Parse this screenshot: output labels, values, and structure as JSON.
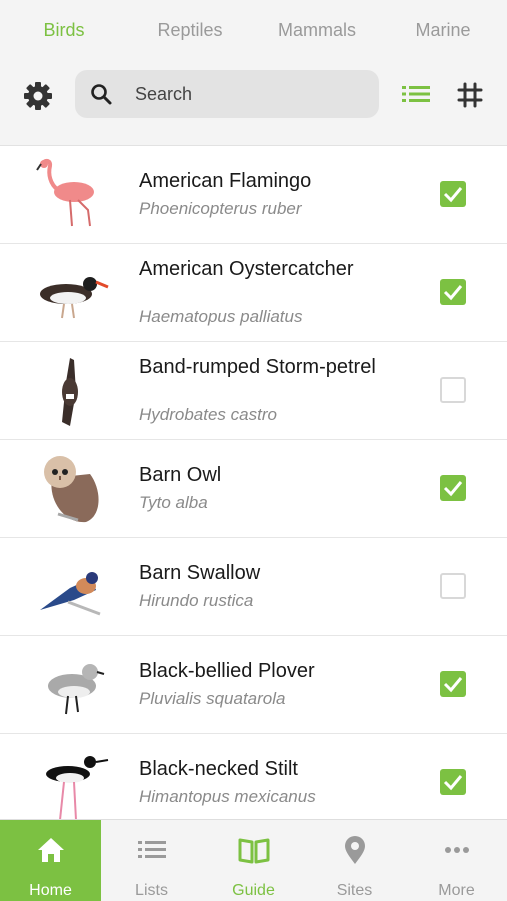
{
  "tabs": [
    {
      "label": "Birds"
    },
    {
      "label": "Reptiles"
    },
    {
      "label": "Mammals"
    },
    {
      "label": "Marine"
    }
  ],
  "search": {
    "placeholder": "Search"
  },
  "colors": {
    "accent": "#7cc142",
    "text": "#1a1a1a",
    "muted": "#8a8a8a"
  },
  "species": [
    {
      "name": "American Flamingo",
      "scientific": "Phoenicopterus ruber",
      "checked": true
    },
    {
      "name": "American Oystercatcher",
      "scientific": "Haematopus palliatus",
      "checked": true
    },
    {
      "name": "Band-rumped Storm-petrel",
      "scientific": "Hydrobates castro",
      "checked": false
    },
    {
      "name": "Barn Owl",
      "scientific": "Tyto alba",
      "checked": true
    },
    {
      "name": "Barn Swallow",
      "scientific": "Hirundo rustica",
      "checked": false
    },
    {
      "name": "Black-bellied Plover",
      "scientific": "Pluvialis squatarola",
      "checked": true
    },
    {
      "name": "Black-necked Stilt",
      "scientific": "Himantopus mexicanus",
      "checked": true
    }
  ],
  "nav": [
    {
      "label": "Home",
      "icon": "home-icon"
    },
    {
      "label": "Lists",
      "icon": "list-icon"
    },
    {
      "label": "Guide",
      "icon": "book-icon"
    },
    {
      "label": "Sites",
      "icon": "map-pin-icon"
    },
    {
      "label": "More",
      "icon": "more-icon"
    }
  ]
}
